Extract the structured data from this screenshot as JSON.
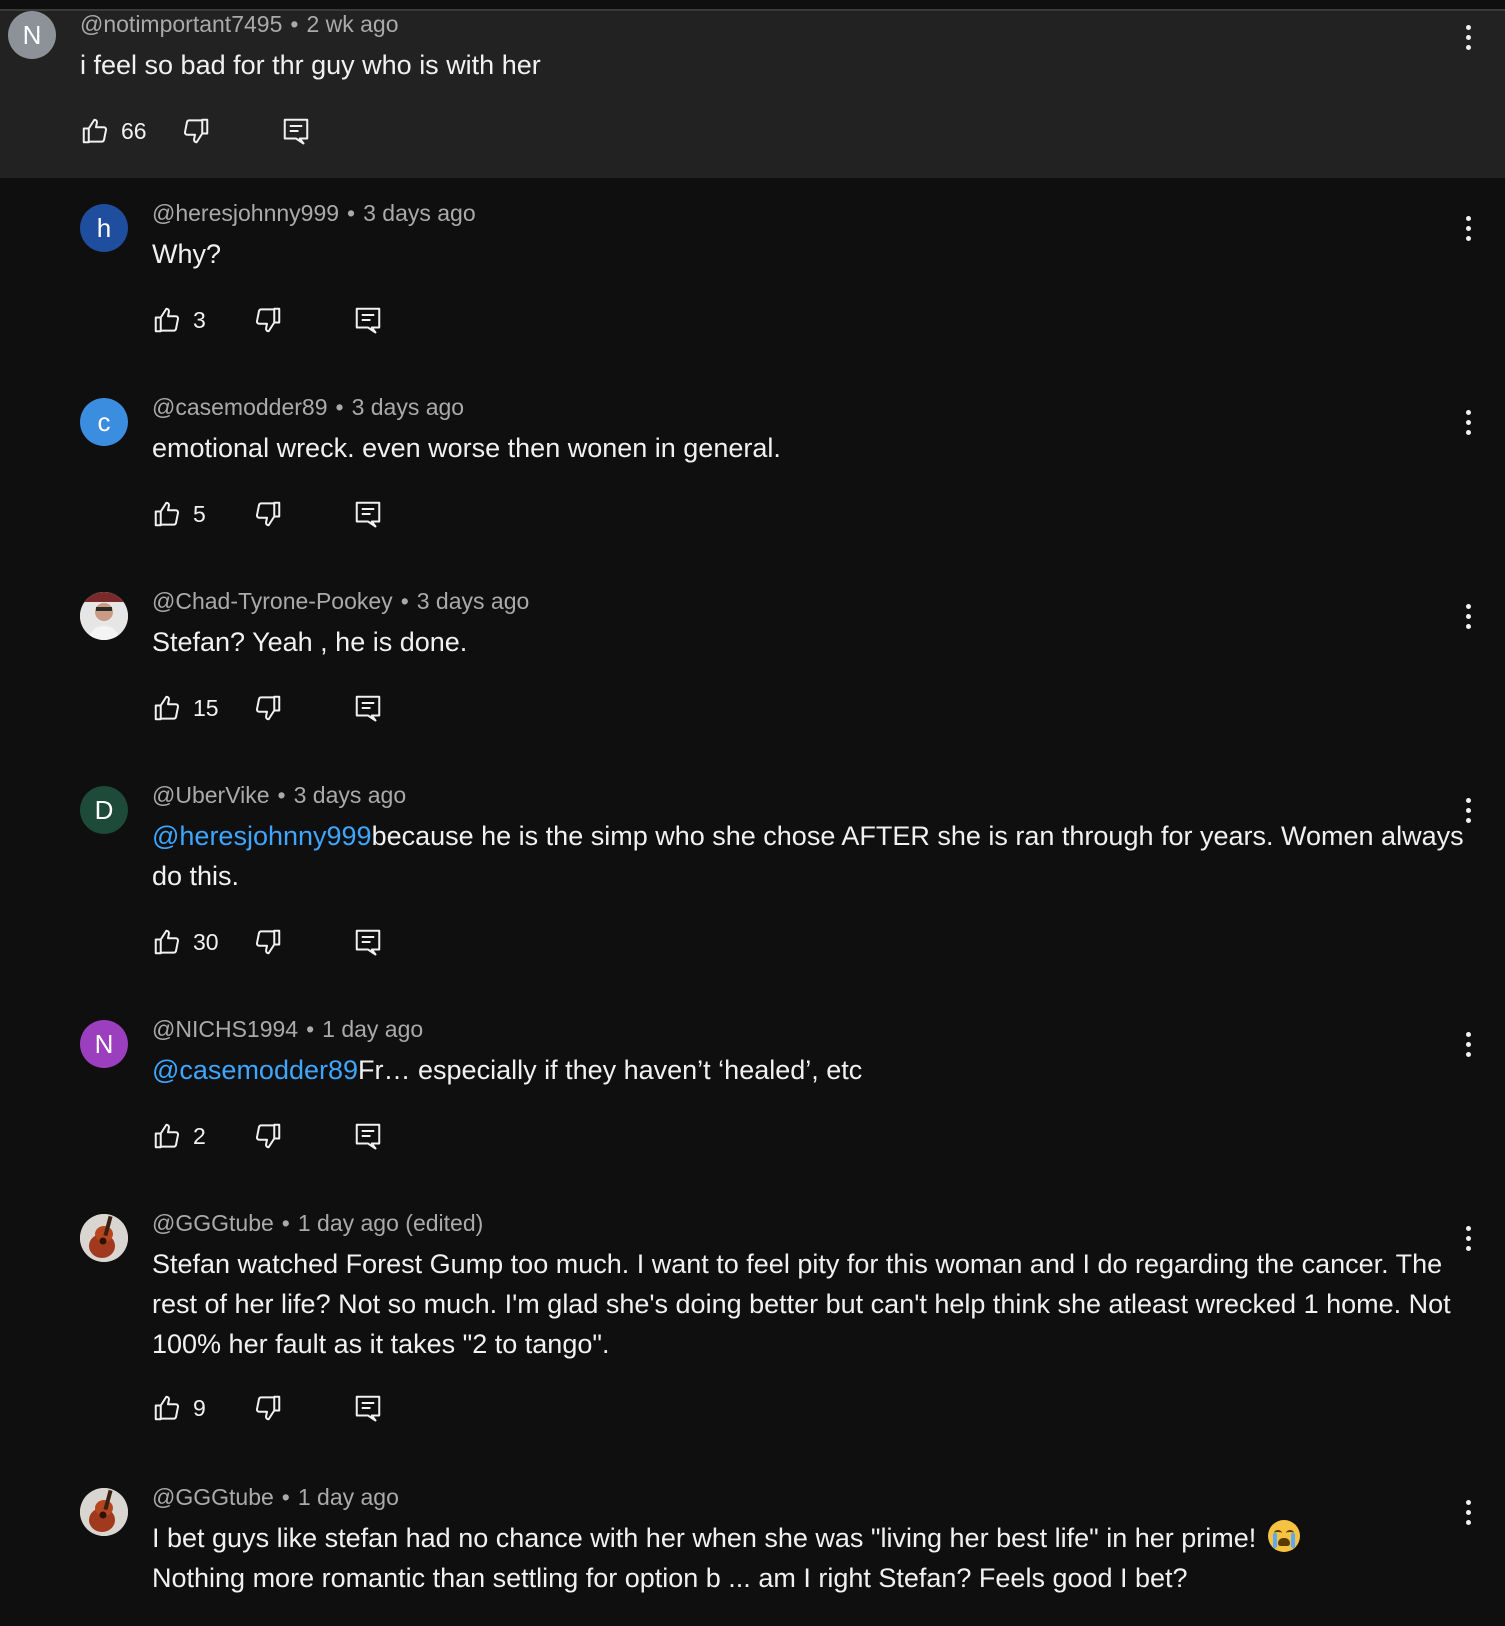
{
  "colors": {
    "background": "#0f0f0f",
    "parent_background": "#222222",
    "mention": "#3ea6ff",
    "meta_text": "#aaaaaa"
  },
  "parent": {
    "avatar_letter": "N",
    "avatar_color": "#8c9298",
    "handle": "@notimportant7495",
    "time": "2 wk ago",
    "text": "i feel so bad for thr guy who is with her",
    "likes": "66"
  },
  "replies": [
    {
      "avatar_letter": "h",
      "avatar_color": "#1f4e9e",
      "handle": "@heresjohnny999",
      "time": "3 days ago",
      "mention": "",
      "text": "Why?",
      "likes": "3"
    },
    {
      "avatar_letter": "c",
      "avatar_color": "#3b8de0",
      "handle": "@casemodder89",
      "time": "3 days ago",
      "mention": "",
      "text": "emotional wreck. even worse then wonen in general.",
      "likes": "5"
    },
    {
      "avatar_letter": "",
      "avatar_color": "#d8d8d8",
      "avatar_icon": "person-photo-icon",
      "handle": "@Chad-Tyrone-Pookey",
      "time": "3 days ago",
      "mention": "",
      "text": "Stefan? Yeah , he is done.",
      "likes": "15"
    },
    {
      "avatar_letter": "D",
      "avatar_color": "#1e4a3a",
      "handle": "@UberVike",
      "time": "3 days ago",
      "mention": "@heresjohnny999",
      "text": "because he is the simp who she chose AFTER she is ran through for years.  Women always do this.",
      "likes": "30"
    },
    {
      "avatar_letter": "N",
      "avatar_color": "#9b3fbf",
      "handle": "@NICHS1994",
      "time": "1 day ago",
      "mention": "@casemodder89",
      "text": "Fr… especially if they haven’t ‘healed’, etc",
      "likes": "2"
    },
    {
      "avatar_letter": "",
      "avatar_color": "#d9d6d2",
      "avatar_icon": "guitar-photo-icon",
      "handle": "@GGGtube",
      "time": "1 day ago (edited)",
      "mention": "",
      "text": "Stefan watched Forest Gump too much.  I want to feel pity for this woman and I do regarding the cancer.  The rest of her life?  Not so much.  I'm glad she's doing better but can't help think she atleast wrecked 1 home.  Not 100% her fault as it takes \"2 to tango\".",
      "likes": "9"
    },
    {
      "avatar_letter": "",
      "avatar_color": "#d9d6d2",
      "avatar_icon": "guitar-photo-icon",
      "handle": "@GGGtube",
      "time": "1 day ago",
      "mention": "",
      "text": "I bet guys like stefan had no chance with her when she was \"living her best life\" in her prime!",
      "text2": "Nothing more romantic than settling for option b ... am I right Stefan?  Feels good I bet?",
      "emoji": "loudly-crying-face-icon",
      "likes": ""
    }
  ]
}
